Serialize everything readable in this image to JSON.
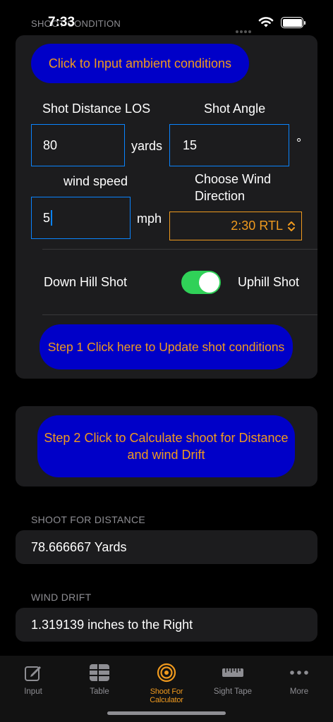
{
  "status": {
    "section_header": "SHOOT CONDITION",
    "time": "7:33"
  },
  "conditions": {
    "ambient_button": "Click to Input ambient conditions",
    "distance_label": "Shot Distance LOS",
    "angle_label": "Shot Angle",
    "distance_value": "80",
    "distance_unit": "yards",
    "angle_value": "15",
    "angle_unit": "°",
    "wind_speed_label": "wind speed",
    "wind_direction_label_line1": "Choose Wind",
    "wind_direction_label_line2": "Direction",
    "wind_speed_value": "5",
    "wind_speed_unit": "mph",
    "wind_direction_value": "2:30 RTL",
    "downhill_label": "Down Hill Shot",
    "uphill_label": "Uphill Shot",
    "uphill_toggle_on": true,
    "step1_button": "Step 1 Click here to Update shot conditions"
  },
  "calculate": {
    "step2_button_line1": "Step 2 Click to Calculate shoot for Distance",
    "step2_button_line2": "and wind Drift"
  },
  "results": {
    "distance_header": "SHOOT FOR DISTANCE",
    "distance_value": "78.666667 Yards",
    "drift_header": "WIND DRIFT",
    "drift_value": "1.319139 inches to the Right"
  },
  "tabbar": {
    "tabs": [
      {
        "label": "Input",
        "icon": "pencil-square-icon"
      },
      {
        "label": "Table",
        "icon": "table-icon"
      },
      {
        "label": "Shoot For Calculator",
        "icon": "target-icon",
        "active": true
      },
      {
        "label": "Sight Tape",
        "icon": "ruler-icon"
      },
      {
        "label": "More",
        "icon": "ellipsis-icon"
      }
    ]
  },
  "colors": {
    "accent": "#f09a1e",
    "button_bg": "#0000c8",
    "field_border": "#0a84ff",
    "toggle_on": "#30d158",
    "card_bg": "#1c1c1e"
  }
}
